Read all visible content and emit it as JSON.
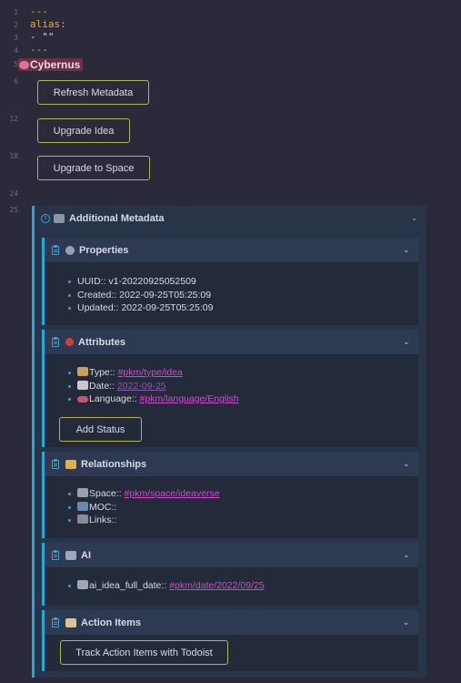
{
  "gutter": [
    "1",
    "2",
    "3",
    "4",
    "5",
    "6",
    "12",
    "18",
    "24",
    "25"
  ],
  "frontmatter": {
    "dash_open": "---",
    "alias_key": "alias:",
    "alias_value": "- \"\"",
    "dash_close": "---"
  },
  "heading": {
    "icon": "brain-icon",
    "text": "Cybernus"
  },
  "buttons": {
    "refresh": "Refresh Metadata",
    "upgrade_idea": "Upgrade Idea",
    "upgrade_space": "Upgrade to Space"
  },
  "additional": {
    "title": "Additional Metadata",
    "icon": "computer-icon"
  },
  "properties": {
    "title": "Properties",
    "items": [
      "UUID:: v1-20220925052509",
      "Created:: 2022-09-25T05:25:09",
      "Updated:: 2022-09-25T05:25:09"
    ]
  },
  "attributes": {
    "title": "Attributes",
    "type_label": "Type::",
    "type_value": "#pkm/type/idea",
    "date_label": "Date::",
    "date_value": "2022-09-25",
    "language_label": "Language::",
    "language_value": "#pkm/language/English",
    "add_status": "Add Status"
  },
  "relationships": {
    "title": "Relationships",
    "space_label": "Space::",
    "space_value": "#pkm/space/ideaverse",
    "moc_label": "MOC::",
    "links_label": "Links::"
  },
  "ai": {
    "title": "AI",
    "item_label": "ai_idea_full_date::",
    "item_value": "#pkm/date/2022/09/25"
  },
  "action_items": {
    "title": "Action Items",
    "button": "Track Action Items with Todoist"
  },
  "colors": {
    "background": "#2b2a3a",
    "callout_border": "#2ba5d8",
    "tag": "#d04ad0",
    "button_border": "#b5b35a"
  }
}
